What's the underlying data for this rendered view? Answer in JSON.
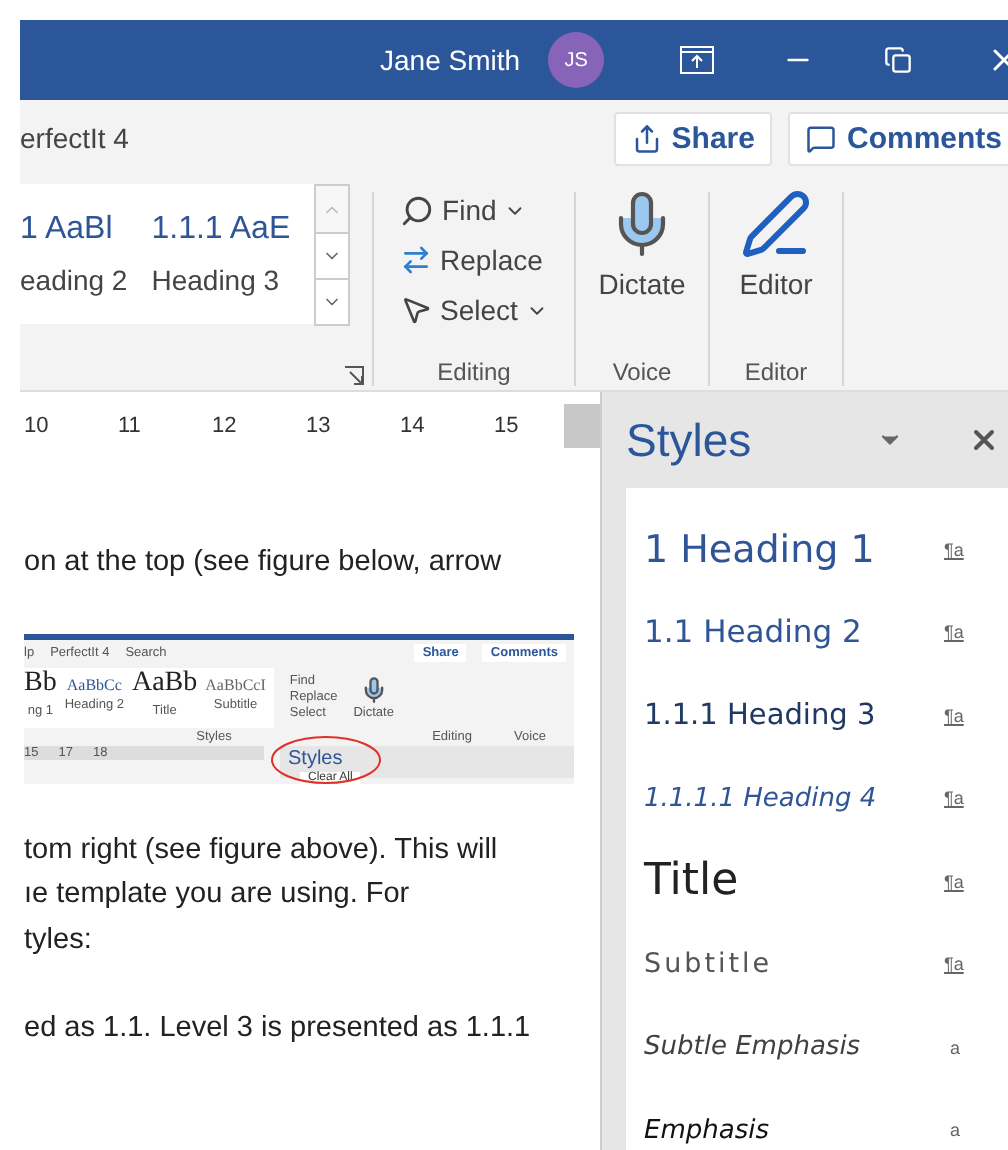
{
  "window": {
    "user_name": "Jane Smith",
    "avatar_initials": "JS"
  },
  "ribbon_tab": "erfectIt 4",
  "share_button": "Share",
  "comments_button": "Comments",
  "style_gallery": [
    {
      "sample": "1  AaBl",
      "label": "eading 2"
    },
    {
      "sample": "1.1.1  AaE",
      "label": "Heading 3"
    }
  ],
  "editing": [
    {
      "kind": "find",
      "label": "Find",
      "dropdown": true
    },
    {
      "kind": "replace",
      "label": "Replace",
      "dropdown": false
    },
    {
      "kind": "select",
      "label": "Select",
      "dropdown": true
    }
  ],
  "dictate_button": "Dictate",
  "editor_button": "Editor",
  "group_labels": {
    "editing": "Editing",
    "voice": "Voice",
    "editor": "Editor"
  },
  "ruler": [
    "10",
    "11",
    "12",
    "13",
    "14",
    "15"
  ],
  "paragraphs": [
    {
      "lines": [
        "on at the top (see figure below, arrow"
      ]
    },
    {
      "kind": "figure"
    },
    {
      "lines": [
        "tom right (see figure above). This will",
        "ıe template you are using. For",
        "tyles:"
      ]
    },
    {
      "lines": [
        "ed as 1.1. Level 3 is presented as 1.1.1"
      ]
    }
  ],
  "figure": {
    "tabs": [
      "lp",
      "PerfectIt 4",
      "Search"
    ],
    "share": "Share",
    "comments": "Comments",
    "styles": [
      {
        "sample": "Bb",
        "label": "ng 1"
      },
      {
        "sample": "AaBbCc",
        "label": "Heading 2"
      },
      {
        "sample": "AaBb",
        "label": "Title"
      },
      {
        "sample": "AaBbCcI",
        "label": "Subtitle"
      }
    ],
    "editing": [
      "Find",
      "Replace",
      "Select"
    ],
    "dictate": "Dictate",
    "group_labels": [
      "Styles",
      "Editing",
      "Voice"
    ],
    "ruler": [
      "15",
      "17",
      "18"
    ],
    "pane_title": "Styles",
    "pane_item": "Clear All"
  },
  "styles_pane": {
    "title": "Styles",
    "items": [
      {
        "label": "1  Heading 1",
        "kind": "heading1",
        "mark": "¶a"
      },
      {
        "label": "1.1  Heading 2",
        "kind": "heading2",
        "mark": "¶a"
      },
      {
        "label": "1.1.1  Heading 3",
        "kind": "heading3",
        "mark": "¶a"
      },
      {
        "label": "1.1.1.1  Heading 4",
        "kind": "heading4",
        "mark": "¶a"
      },
      {
        "label": "Title",
        "kind": "title",
        "mark": "¶a"
      },
      {
        "label": "Subtitle",
        "kind": "subtitle",
        "mark": "¶a"
      },
      {
        "label": "Subtle Emphasis",
        "kind": "subtle",
        "mark": "a"
      },
      {
        "label": "Emphasis",
        "kind": "emphasis",
        "mark": "a"
      }
    ]
  }
}
